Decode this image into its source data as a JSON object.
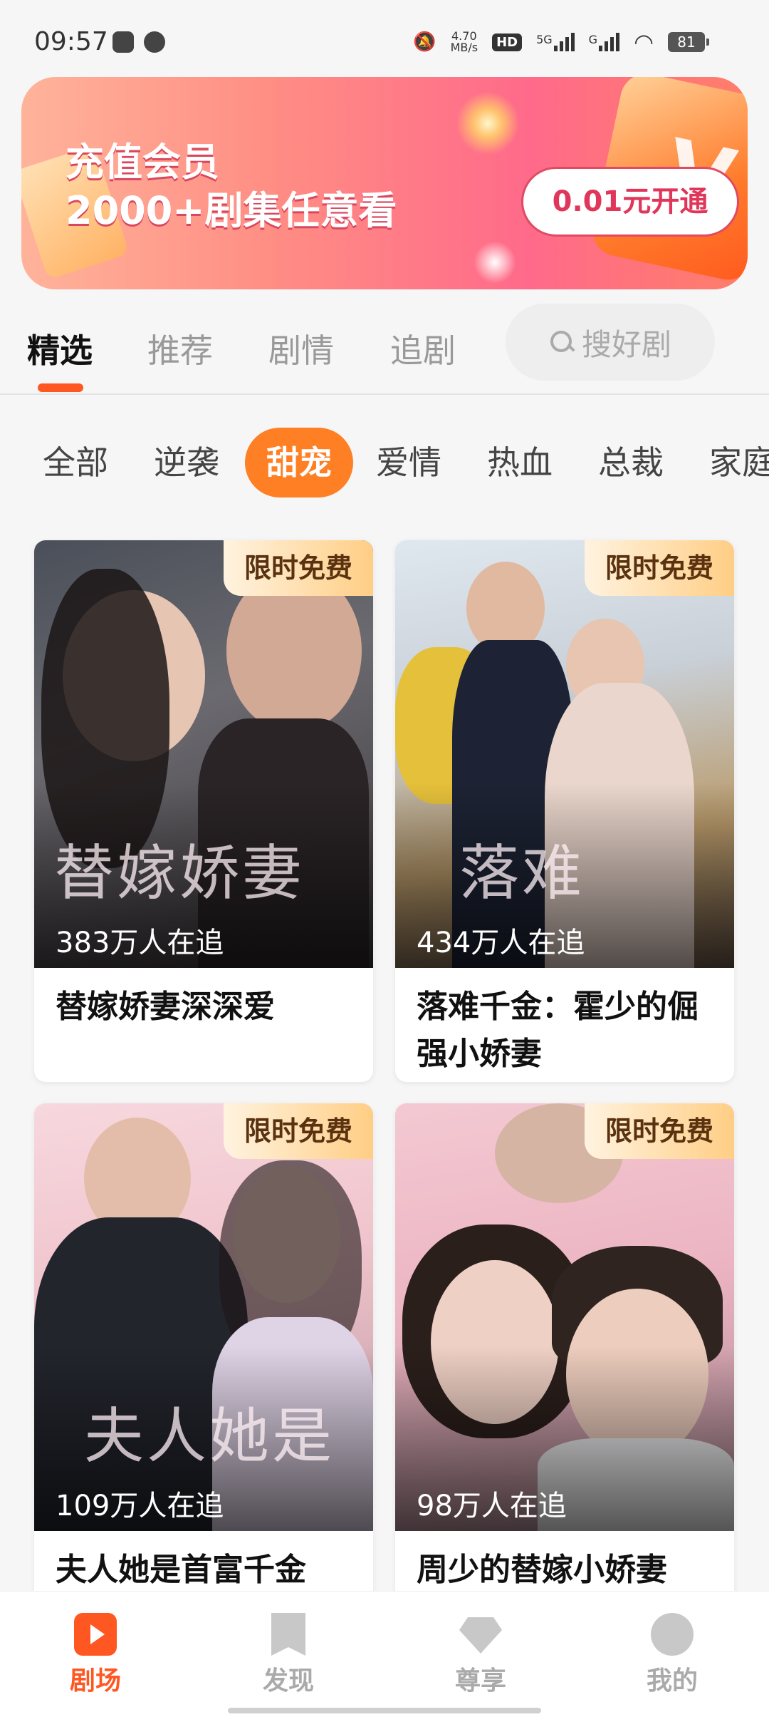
{
  "status": {
    "time": "09:57",
    "speed_top": "4.70",
    "speed_unit": "MB/s",
    "hd": "HD",
    "net1": "5G",
    "net2": "G",
    "battery": "81"
  },
  "banner": {
    "title_line1": "充值会员",
    "title_line2": "2000+剧集任意看",
    "cta": "0.01元开通"
  },
  "tabs": {
    "items": [
      "精选",
      "推荐",
      "剧情",
      "追剧"
    ],
    "search_label": "搜好剧"
  },
  "categories": [
    "全部",
    "逆袭",
    "甜宠",
    "爱情",
    "热血",
    "总裁",
    "家庭"
  ],
  "cards": [
    {
      "badge": "限时免费",
      "viewers": "383万人在追",
      "title": "替嫁娇妻深深爱",
      "art": "替嫁娇妻"
    },
    {
      "badge": "限时免费",
      "viewers": "434万人在追",
      "title": "落难千金：霍少的倔强小娇妻",
      "art": "落难"
    },
    {
      "badge": "限时免费",
      "viewers": "109万人在追",
      "title": "夫人她是首富千金",
      "art": "夫人她是"
    },
    {
      "badge": "限时免费",
      "viewers": "98万人在追",
      "title": "周少的替嫁小娇妻",
      "art": ""
    }
  ],
  "nav": [
    "剧场",
    "发现",
    "尊享",
    "我的"
  ],
  "colors": {
    "accent": "#ff5722",
    "category_active": "#ff7f24"
  }
}
